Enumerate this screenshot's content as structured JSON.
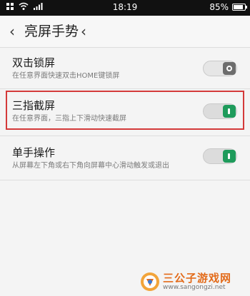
{
  "status_bar": {
    "time": "18:19",
    "battery_text": "85%",
    "battery_level": 0.85,
    "icons": [
      "grid-icon",
      "wifi-icon",
      "signal-icon",
      "battery-icon"
    ]
  },
  "nav": {
    "title": "亮屏手势",
    "back_label": "‹",
    "extra_label": "‹"
  },
  "settings": [
    {
      "title": "双击锁屏",
      "desc": "在任意界面快速双击HOME键锁屏",
      "enabled": false
    },
    {
      "title": "三指截屏",
      "desc": "在任意界面，三指上下滑动快速截屏",
      "enabled": true
    },
    {
      "title": "单手操作",
      "desc": "从屏幕左下角或右下角向屏幕中心滑动触发或退出",
      "enabled": true
    }
  ],
  "watermark": {
    "name": "三公子游戏网",
    "url": "www.sangongzi.net"
  },
  "colors": {
    "toggle_on": "#1e9b5b",
    "toggle_off": "#6d6d6d",
    "highlight": "#d43a3a",
    "watermark_text": "#e36b1a"
  }
}
